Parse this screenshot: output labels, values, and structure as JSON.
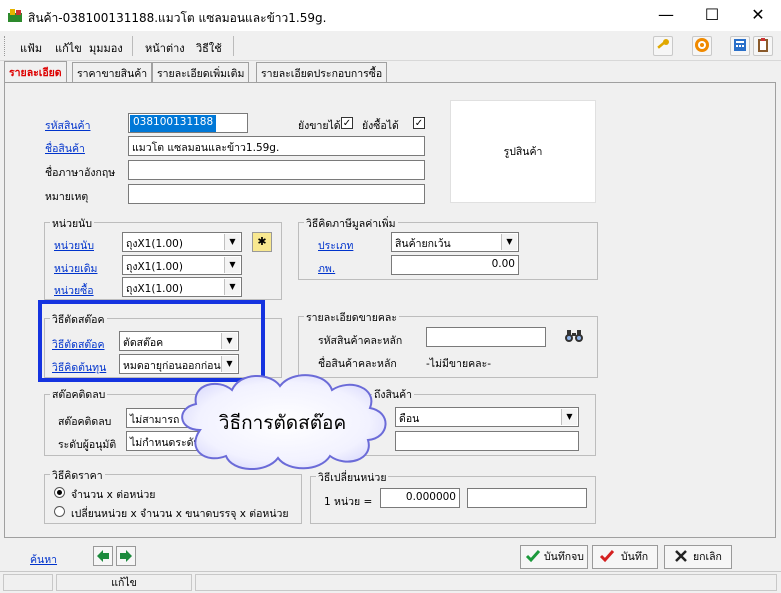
{
  "window": {
    "title": "สินค้า-038100131188.แมวโต แซลมอนและข้าว1.59g.",
    "minimize": "—",
    "maximize": "☐",
    "close": "✕"
  },
  "menu": {
    "items": [
      "แฟ้ม",
      "แก้ไข",
      "มุมมอง",
      "หน้าต่าง",
      "วิธีใช้"
    ]
  },
  "toolbar": {
    "icons": [
      "key-icon",
      "target-icon",
      "calculator-icon",
      "clipboard-icon"
    ]
  },
  "tabs": [
    "รายละเอียด",
    "ราคาขายสินค้า",
    "รายละเอียดเพิ่มเติม",
    "รายละเอียดประกอบการซื้อ"
  ],
  "form": {
    "code_label": "รหัสสินค้า",
    "code_value": "038100131188",
    "can_sell_label": "ยังขายได้",
    "can_buy_label": "ยังซื้อได้",
    "name_label": "ชื่อสินค้า",
    "name_value": "แมวโต แซลมอนและข้าว1.59g.",
    "eng_name_label": "ชื่อภาษาอังกฤษ",
    "eng_name_value": "",
    "note_label": "หมายเหตุ",
    "note_value": "",
    "image_label": "รูปสินค้า"
  },
  "units": {
    "title": "หน่วยนับ",
    "unit_label": "หน่วยนับ",
    "unit_value": "ถุงX1(1.00)",
    "old_unit_label": "หน่วยเดิม",
    "old_unit_value": "ถุงX1(1.00)",
    "buy_unit_label": "หน่วยซื้อ",
    "buy_unit_value": "ถุงX1(1.00)"
  },
  "vat": {
    "title": "วิธีคิดภาษีมูลค่าเพิ่ม",
    "type_label": "ประเภท",
    "type_value": "สินค้ายกเว้น",
    "rate_label": "ภพ.",
    "rate_value": "0.00"
  },
  "stock_cut": {
    "title": "วิธีตัดสต๊อค",
    "method_label": "วิธีตัดสต๊อค",
    "method_value": "ตัดสต๊อค",
    "cost_label": "วิธีคิดต้นทุน",
    "cost_value": "หมดอายุก่อนออกก่อน"
  },
  "variant": {
    "title": "รายละเอียดขายคละ",
    "main_code_label": "รหัสสินค้าคละหลัก",
    "main_code_value": "",
    "main_name_label": "ชื่อสินค้าคละหลัก",
    "main_name_value": "-ไม่มีขายคละ-"
  },
  "negative_stock": {
    "title": "สต๊อคติดลบ",
    "stock_label": "สต๊อคติดลบ",
    "stock_value": "ไม่สามารถ",
    "approve_label": "ระดับผู้อนุมัติ",
    "approve_value": "ไม่กำหนดระดับ"
  },
  "product_access": {
    "title": "ถึงสินค้า",
    "select_value": "ดือน",
    "text_value": ""
  },
  "callout": {
    "text": "วิธีการตัดสต๊อค"
  },
  "pricing": {
    "title": "วิธีคิดราคา",
    "option1": "จำนวน x ต่อหน่วย",
    "option2": "เปลี่ยนหน่วย x จำนวน x ขนาดบรรจุ x ต่อหน่วย"
  },
  "unit_change": {
    "title": "วิธีเปลี่ยนหน่วย",
    "one_unit_label": "1 หน่วย =",
    "one_unit_value": "0.000000",
    "extra_value": ""
  },
  "bottom": {
    "search_label": "ค้นหา",
    "save_close_label": "บันทึกจบ",
    "save_label": "บันทึก",
    "cancel_label": "ยกเลิก"
  },
  "status": {
    "mode": "แก้ไข"
  },
  "colors": {
    "accent_blue": "#0033cc",
    "tab_active": "#dd0000",
    "highlight_frame": "#1533e0",
    "callout_border": "#6b6bd8"
  }
}
